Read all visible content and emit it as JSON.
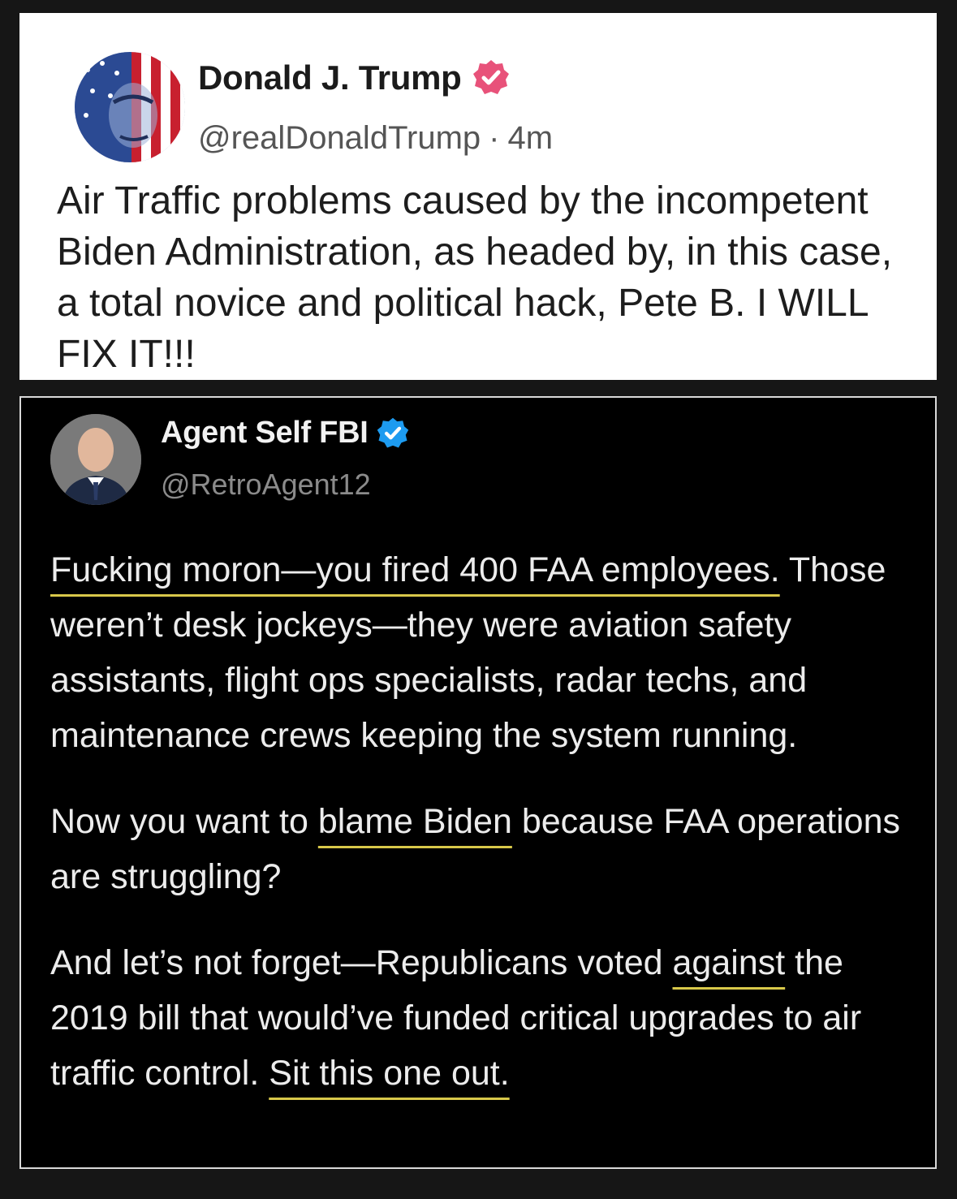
{
  "top_post": {
    "author_name": "Donald J. Trump",
    "handle": "@realDonaldTrump",
    "separator": "·",
    "time": "4m",
    "text": "Air Traffic problems caused by the incompetent Biden Administration, as headed by, in this case, a total novice and political hack, Pete B. I WILL FIX IT!!!",
    "badge_color": "#e8527a",
    "verified_icon": "verified-badge-icon"
  },
  "bottom_post": {
    "author_name": "Agent Self FBI",
    "handle": "@RetroAgent12",
    "badge_color": "#1d9bf0",
    "verified_icon": "verified-badge-icon",
    "paragraph1": {
      "underlined": "Fucking moron—you fired 400 FAA employees.",
      "rest": " Those weren’t desk jockeys—they were aviation safety assistants, flight ops specialists, radar techs, and maintenance crews keeping the system running."
    },
    "paragraph2": {
      "before": "Now you want to ",
      "underlined": "blame Biden",
      "after": " because FAA operations are struggling?"
    },
    "paragraph3": {
      "before": "And let’s not forget—Republicans voted ",
      "underlined1": "against",
      "middle": " the 2019 bill that would’ve funded critical upgrades to air traffic control. ",
      "underlined2": "Sit this one out."
    },
    "underline_color": "#d8c84a"
  }
}
